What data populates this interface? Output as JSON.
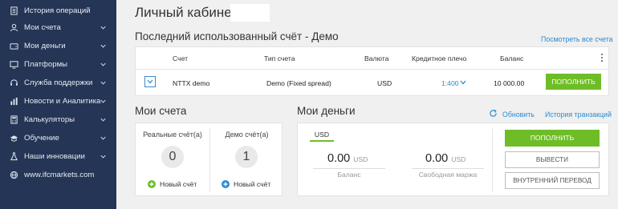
{
  "sidebar": {
    "items": [
      {
        "label": "История операций",
        "icon": "document-list-icon",
        "has_chevron": false
      },
      {
        "label": "Мои счета",
        "icon": "user-icon",
        "has_chevron": true
      },
      {
        "label": "Мои деньги",
        "icon": "wallet-icon",
        "has_chevron": true
      },
      {
        "label": "Платформы",
        "icon": "monitor-icon",
        "has_chevron": true
      },
      {
        "label": "Служба поддержки",
        "icon": "headset-icon",
        "has_chevron": true
      },
      {
        "label": "Новости и Аналитика",
        "icon": "bar-chart-icon",
        "has_chevron": true
      },
      {
        "label": "Калькуляторы",
        "icon": "calculator-icon",
        "has_chevron": true
      },
      {
        "label": "Обучение",
        "icon": "graduation-cap-icon",
        "has_chevron": true
      },
      {
        "label": "Наши инновации",
        "icon": "flask-icon",
        "has_chevron": true
      },
      {
        "label": "www.ifcmarkets.com",
        "icon": "globe-icon",
        "has_chevron": false
      }
    ]
  },
  "header": {
    "title": "Личный кабинет"
  },
  "last_account": {
    "title": "Последний использованный счёт - Демо",
    "view_all_link": "Посмотреть все счета",
    "columns": [
      "Счет",
      "Тип счета",
      "Валюта",
      "Кредитное плечо",
      "Баланс"
    ],
    "row": {
      "account": "NTTX demo",
      "type": "Demo (Fixed spread)",
      "currency": "USD",
      "leverage": "1:400",
      "balance": "10 000.00",
      "action": "ПОПОЛНИТЬ"
    }
  },
  "my_accounts": {
    "title": "Мои счета",
    "real": {
      "label": "Реальные счёт(а)",
      "count": "0",
      "new": "Новый счёт"
    },
    "demo": {
      "label": "Демо счёт(а)",
      "count": "1",
      "new": "Новый счёт"
    }
  },
  "my_money": {
    "title": "Мои деньги",
    "refresh_link": "Обновить",
    "history_link": "История транзакций",
    "currency_tab": "USD",
    "balance": {
      "value": "0.00",
      "currency": "USD",
      "label": "Баланс"
    },
    "free_margin": {
      "value": "0.00",
      "currency": "USD",
      "label": "Свободная маржа"
    },
    "buttons": {
      "deposit": "ПОПОЛНИТЬ",
      "withdraw": "ВЫВЕСТИ",
      "transfer": "ВНУТРЕННИЙ ПЕРЕВОД"
    }
  },
  "colors": {
    "sidebar_bg": "#253555",
    "accent_green": "#6ebd27",
    "link_blue": "#2a8bd0",
    "page_bg": "#f0f0f0"
  }
}
